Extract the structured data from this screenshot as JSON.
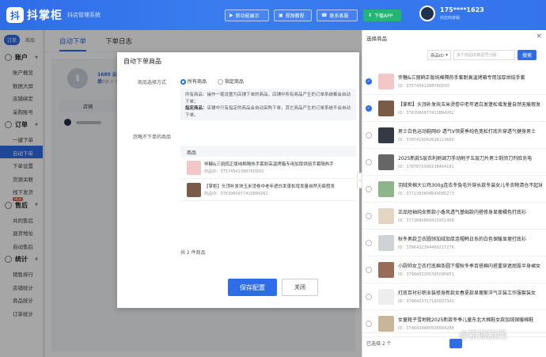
{
  "app": {
    "logo_mark": "抖",
    "name": "抖掌柜",
    "subtitle": "抖店管理系统"
  },
  "topbar": {
    "buttons": [
      {
        "label": "新功能展示",
        "icon": "play-icon"
      },
      {
        "label": "视频教程",
        "icon": "video-icon"
      },
      {
        "label": "联系客服",
        "icon": "headset-icon"
      },
      {
        "label": "下载APP",
        "icon": "download-icon"
      }
    ],
    "user": {
      "phone": "175****1623",
      "sub": "抖店商家版"
    }
  },
  "sidebar": {
    "tabs": [
      "订单",
      "商品"
    ],
    "groups": [
      {
        "title": "账户",
        "items": [
          "账户概览",
          "数据大屏",
          "店铺绑定",
          "采购账号"
        ]
      },
      {
        "title": "订单",
        "items": [
          "一键下单",
          "自动下单",
          "下单设置",
          "货源关联",
          "线下发货"
        ]
      },
      {
        "title": "售后",
        "items": [
          "共同售后",
          "退货地址",
          "自动售后"
        ]
      },
      {
        "title": "统计",
        "items": [
          "销售排行",
          "店铺统计",
          "商品统计",
          "订单统计"
        ]
      }
    ],
    "badge": "NEW"
  },
  "main": {
    "tabs": [
      "自动下单",
      "下单日志"
    ],
    "card_value": "1680 云下单",
    "card_sub": "已开启 0 个",
    "store_head": "店铺"
  },
  "dialog": {
    "title": "自动下单商品",
    "mode_label": "商品选择方式",
    "options": [
      "所有商品",
      "指定商品"
    ],
    "note_line1": "所有商品：操作一笔设置为店铺下单的商品，店铺中所有商品产生的订单系统都会自动下单；",
    "note_bold2": "指定商品：",
    "note_line2": "店铺中只有指定的商品会自动采购下单，其它商品产生的订单系统不会自动下单。",
    "exclude_label": "忽略不下单的商品",
    "table_head": "商品",
    "products": [
      {
        "name": "伴糖&三丽鸥正版纯棉隔热手套耐高温烤箱专用加厚烘焙手套隔热手",
        "id": "商品ID：3757454138876093O"
      },
      {
        "name": "【掌柜】头顶补发块玉米烫卷中老年遮白发蓬松增发量自然无痕假发",
        "id": "商品ID：3763960977410884262"
      }
    ],
    "total": "共 2 件商品",
    "save": "保存配置",
    "close": "关闭"
  },
  "right_panel": {
    "title": "选择商品",
    "select_label": "商品ID",
    "input_placeholder": "多个商品ID用逗号分隔",
    "search": "搜索",
    "items": [
      {
        "name": "伴糖&三丽鸥正版纯棉隔热手套耐高温烤箱专用加厚烘焙手套",
        "id": "ID：3757454138876093O",
        "checked": true,
        "color": "#f3c7c7"
      },
      {
        "name": "【掌柜】头顶补发块玉米烫卷中老年遮白发蓬松增发量自然无痕假发",
        "id": "ID：3763960977410884262",
        "checked": true,
        "color": "#7a5b48"
      },
      {
        "name": "男士白色运动鞋网纱 透气V领夏季纯色宽松打底外穿透气健身男士",
        "id": "ID：3765419042626113680",
        "checked": false,
        "color": "#333a44"
      },
      {
        "name": "2025新款5层衣利刷调刀手动刷子五层刀片男士剃须刀剂脸充电",
        "id": "ID：3767875996138464191",
        "checked": false,
        "color": "#666"
      },
      {
        "name": "羽绒夹棉大公鸡300g连衣冬兔毛外穿长款冬装女儿冬衣物清仓不起球",
        "id": "ID：3771393808649085273",
        "checked": false,
        "color": "#8db58a"
      },
      {
        "name": "正品短袖纯女新款小香风透气基础款内搭修身显瘦橘色打底衫",
        "id": "ID：3772680860415951458",
        "checked": false,
        "color": "#e4d4c4"
      },
      {
        "name": "秋冬男款卫衣圆领加绒加厚连帽韩日系的白色保暖显瘦打底衫",
        "id": "ID：3796432394460217276",
        "checked": false,
        "color": "#cfd3d8"
      },
      {
        "name": "小厨帅女卫衣打底棉条圆下摆秋冬季百搭棉内搭重穿遮屁股半身裙女",
        "id": "ID：3796433305395095651",
        "checked": false,
        "color": "#9b6b5a"
      },
      {
        "name": "打底百衬衫职业装修身新款女春夏款显瘦斯洋气正装工作服套装女",
        "id": "ID：3796433717160007341",
        "checked": false,
        "color": "#eee"
      },
      {
        "name": "女童靴子雪地靴2025新款冬季儿童东北大棉鞋女款加绒保暖棉鞋",
        "id": "ID：3796439480509584288",
        "checked": false,
        "color": "#c9b59a"
      }
    ],
    "selected_count": "已选择 2 个"
  },
  "watermark": "@新派新闻"
}
